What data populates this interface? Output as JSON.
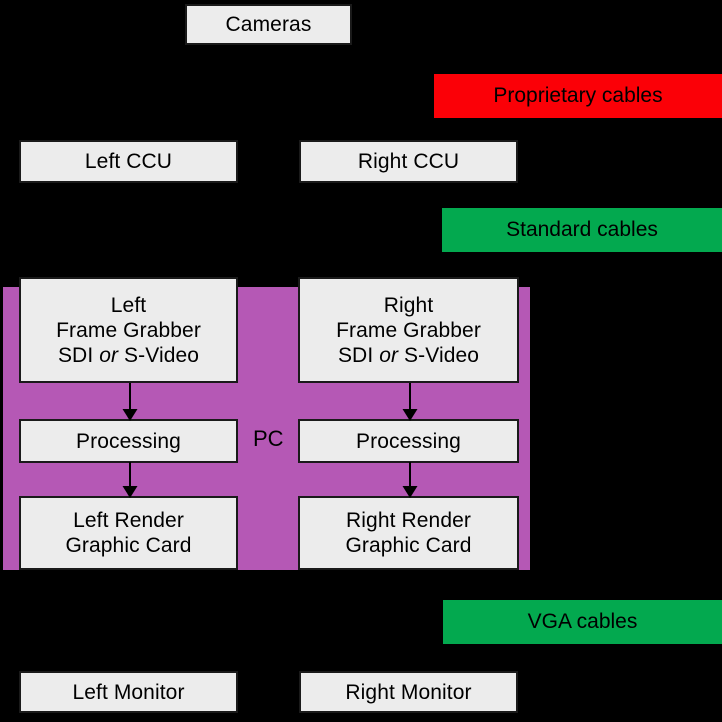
{
  "diagram": {
    "title_node": {
      "label": "Cameras"
    },
    "pc": {
      "label": "PC",
      "color": "#b558b5"
    },
    "cables": [
      {
        "id": "proprietary",
        "label": "Proprietary cables",
        "color": "#fb0007"
      },
      {
        "id": "standard",
        "label": "Standard cables",
        "color": "#03a94f"
      },
      {
        "id": "vga",
        "label": "VGA cables",
        "color": "#03a94f"
      }
    ],
    "ccu": {
      "left": "Left CCU",
      "right": "Right CCU"
    },
    "frame_grabber": {
      "left_line1": "Left",
      "left_line2": "Frame Grabber",
      "left_line3_a": "SDI ",
      "left_line3_em": "or",
      "left_line3_b": " S-Video",
      "right_line1": "Right",
      "right_line2": "Frame Grabber",
      "right_line3_a": "SDI ",
      "right_line3_em": "or",
      "right_line3_b": " S-Video"
    },
    "processing": {
      "left": "Processing",
      "right": "Processing"
    },
    "render": {
      "left_line1": "Left Render",
      "left_line2": "Graphic Card",
      "right_line1": "Right Render",
      "right_line2": "Graphic Card"
    },
    "monitors": {
      "left": "Left Monitor",
      "right": "Right Monitor"
    },
    "colors": {
      "background": "#000000",
      "node_fill": "#ececec",
      "node_border": "#1a1a1a",
      "pc_fill": "#b558b5",
      "proprietary": "#fb0007",
      "standard": "#03a94f",
      "vga": "#03a94f"
    }
  }
}
